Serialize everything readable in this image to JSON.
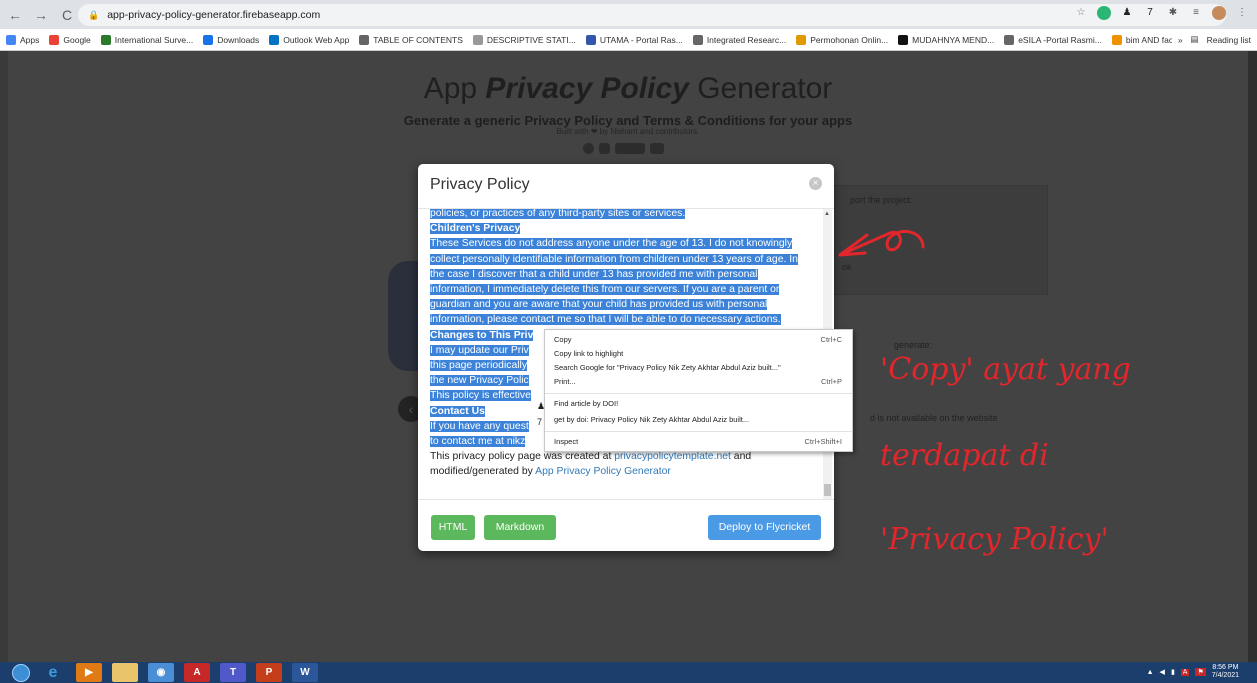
{
  "browser": {
    "url": "app-privacy-policy-generator.firebaseapp.com",
    "bookmarks": [
      {
        "label": "Apps",
        "color": "#4285f4"
      },
      {
        "label": "Google",
        "color": "#ea4335"
      },
      {
        "label": "International Surve...",
        "color": "#2a7a2a"
      },
      {
        "label": "Downloads",
        "color": "#1a73e8"
      },
      {
        "label": "Outlook Web App",
        "color": "#0072c6"
      },
      {
        "label": "TABLE OF CONTENTS",
        "color": "#666666"
      },
      {
        "label": "DESCRIPTIVE STATI...",
        "color": "#999999"
      },
      {
        "label": "UTAMA - Portal Ras...",
        "color": "#3355aa"
      },
      {
        "label": "Integrated Researc...",
        "color": "#666666"
      },
      {
        "label": "Permohonan Onlin...",
        "color": "#e09a00"
      },
      {
        "label": "MUDAHNYA MEND...",
        "color": "#111111"
      },
      {
        "label": "eSILA -Portal Rasmi...",
        "color": "#666666"
      },
      {
        "label": "bim AND facilities...",
        "color": "#f29100"
      }
    ],
    "reading_list": "Reading list"
  },
  "page": {
    "title_plain": "App ",
    "title_italic": "Privacy Policy",
    "title_end": " Generator",
    "subtitle": "Generate a generic Privacy Policy and Terms & Conditions for your apps",
    "built_with": "Built with ❤ by Nishant and contributors.",
    "bg_support": "port the project:",
    "bg_ok": "ok",
    "bg_generate": "generate:",
    "bg_available": "d is not available on the website"
  },
  "modal": {
    "title": "Privacy Policy",
    "close_glyph": "×",
    "text": {
      "l1": "policies, or practices of any third-party sites or services.",
      "h_children": "Children's Privacy",
      "c1": "These Services do not address anyone under the age of 13. I do not knowingly",
      "c2": "collect personally identifiable information from children under 13 years of age. In",
      "c3": "the case I discover that a child under 13 has provided me with personal",
      "c4": "information, I immediately delete this from our servers. If you are a parent or",
      "c5": "guardian and you are aware that your child has provided us with personal",
      "c6": "information, please contact me so that I will be able to do necessary actions.",
      "h_changes": "Changes to This Priv",
      "ch1": "I may update our Priv",
      "ch2": "this page periodically",
      "ch3": "the new Privacy Polic",
      "ch4": "This policy is effective",
      "h_contact": "Contact Us",
      "ct1": "If you have any quest",
      "ct2": "to contact me at nikz",
      "created_prefix": "This privacy policy page was created at ",
      "created_link": "privacypolicytemplate.net",
      "created_mid": " and",
      "modified_prefix": "modified/generated by ",
      "modified_link": "App Privacy Policy Generator"
    },
    "buttons": {
      "html": "HTML",
      "markdown": "Markdown",
      "deploy": "Deploy to Flycricket"
    }
  },
  "context_menu": {
    "items": [
      {
        "label": "Copy",
        "shortcut": "Ctrl+C"
      },
      {
        "label": "Copy link to highlight",
        "shortcut": ""
      },
      {
        "label": "Search Google for \"Privacy Policy Nik Zety Akhtar Abdul Aziz built...\"",
        "shortcut": ""
      },
      {
        "label": "Print...",
        "shortcut": "Ctrl+P"
      },
      {
        "label": "Find article by DOI!",
        "shortcut": ""
      },
      {
        "label": "get by doi: Privacy Policy Nik Zety Akhtar Abdul Aziz built...",
        "shortcut": ""
      },
      {
        "label": "Inspect",
        "shortcut": "Ctrl+Shift+I"
      }
    ]
  },
  "annotation": {
    "line1": "'Copy' ayat yang",
    "line2": "terdapat di",
    "line3": "'Privacy Policy'",
    "color": "#e3262b"
  },
  "taskbar": {
    "time": "8:56 PM",
    "date": "7/4/2021"
  }
}
